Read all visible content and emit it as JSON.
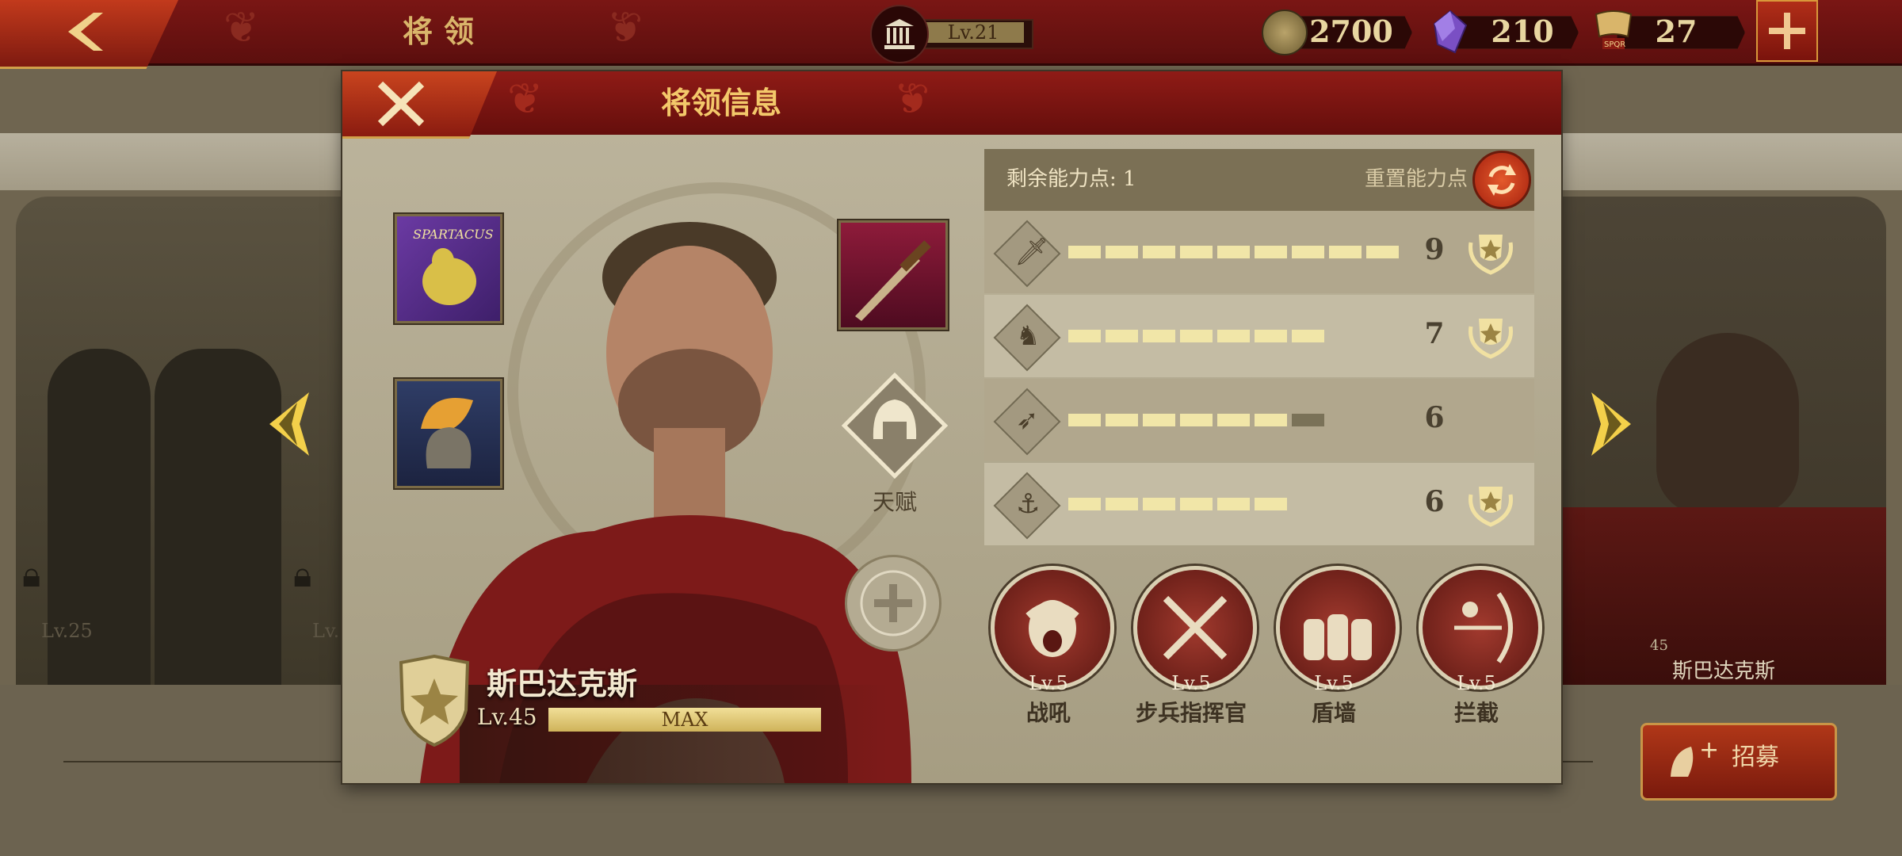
{
  "topbar": {
    "title": "将领",
    "building_level": "Lv.21",
    "resources": [
      {
        "name": "coins",
        "value": "2700",
        "icon": "coin-icon"
      },
      {
        "name": "gems",
        "value": "210",
        "icon": "purple-gem-icon"
      },
      {
        "name": "spqr",
        "value": "27",
        "icon": "spqr-banner-icon"
      }
    ]
  },
  "background": {
    "locked_general_1_level": "Lv.25",
    "locked_general_2_level": "Lv.",
    "next_general_name": "斯巴达克斯",
    "next_general_level": "45"
  },
  "recruit": {
    "label": "招募"
  },
  "modal": {
    "title": "将领信息",
    "talent_label": "天赋",
    "general": {
      "name": "斯巴达克斯",
      "level": "Lv.45",
      "xp_label": "MAX",
      "xp_fraction": 1.0
    },
    "stats_header": {
      "remaining_label": "剩余能力点: 1",
      "reset_label": "重置能力点"
    },
    "stats": [
      {
        "icon": "sword-icon",
        "value": "9",
        "filled": 9,
        "max": 9,
        "badge": true
      },
      {
        "icon": "horse-icon",
        "value": "7",
        "filled": 7,
        "max": 7,
        "badge": true
      },
      {
        "icon": "bow-icon",
        "value": "6",
        "filled": 6,
        "max": 7,
        "badge": false
      },
      {
        "icon": "anchor-icon",
        "value": "6",
        "filled": 6,
        "max": 6,
        "badge": true
      }
    ],
    "skills": [
      {
        "level": "Lv.5",
        "name": "战吼",
        "icon": "warcry-icon"
      },
      {
        "level": "Lv.5",
        "name": "步兵指挥官",
        "icon": "crossed-swords-icon"
      },
      {
        "level": "Lv.5",
        "name": "盾墙",
        "icon": "shield-wall-icon"
      },
      {
        "level": "Lv.5",
        "name": "拦截",
        "icon": "archer-icon"
      }
    ]
  },
  "colors": {
    "header_red": "#7a1614",
    "gold": "#f3c86a",
    "panel": "#bdb59d"
  }
}
